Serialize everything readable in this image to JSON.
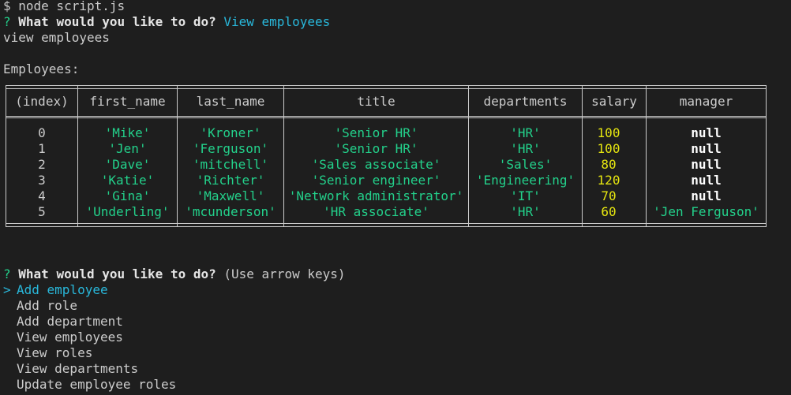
{
  "terminal": {
    "command_line": "$ node script.js",
    "prompt1": {
      "mark": "?",
      "question": "What would you like to do?",
      "answer": "View employees"
    },
    "echo": "view employees",
    "table_title": "Employees:",
    "table": {
      "headers": [
        "(index)",
        "first_name",
        "last_name",
        "title",
        "departments",
        "salary",
        "manager"
      ],
      "rows": [
        [
          "0",
          "'Mike'",
          "'Kroner'",
          "'Senior HR'",
          "'HR'",
          "100",
          "null"
        ],
        [
          "1",
          "'Jen'",
          "'Ferguson'",
          "'Senior HR'",
          "'HR'",
          "100",
          "null"
        ],
        [
          "2",
          "'Dave'",
          "'mitchell'",
          "'Sales associate'",
          "'Sales'",
          "80",
          "null"
        ],
        [
          "3",
          "'Katie'",
          "'Richter'",
          "'Senior engineer'",
          "'Engineering'",
          "120",
          "null"
        ],
        [
          "4",
          "'Gina'",
          "'Maxwell'",
          "'Network administrator'",
          "'IT'",
          "70",
          "null"
        ],
        [
          "5",
          "'Underling'",
          "'mcunderson'",
          "'HR associate'",
          "'HR'",
          "60",
          "'Jen Ferguson'"
        ]
      ]
    },
    "prompt2": {
      "mark": "?",
      "question": "What would you like to do?",
      "hint": "(Use arrow keys)",
      "pointer": ">",
      "options": [
        "Add employee",
        "Add role",
        "Add department",
        "View employees",
        "View roles",
        "View departments",
        "Update employee roles"
      ],
      "selected_index": 0
    },
    "colors": {
      "background": "#1e1e1e",
      "text": "#cccccc",
      "string": "#23d18b",
      "number": "#e5e510",
      "accent": "#29b8db"
    }
  }
}
